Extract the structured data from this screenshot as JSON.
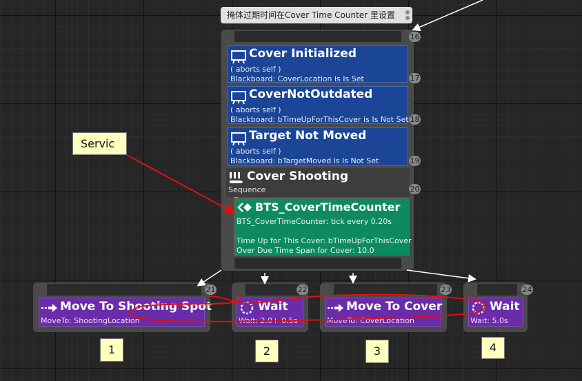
{
  "comment": {
    "text": "掩体过期时间在Cover Time Counter 里设置"
  },
  "composite": {
    "index": "16"
  },
  "decorators": [
    {
      "title": "Cover  Initialized",
      "sub1": "( aborts self )",
      "sub2": "Blackboard: CoverLocation is Is Set",
      "index": "17",
      "icon": "blackboard-icon"
    },
    {
      "title": "CoverNotOutdated",
      "sub1": "( aborts self )",
      "sub2": "Blackboard: bTimeUpForThisCover is Is Not Set",
      "index": "18",
      "icon": "blackboard-icon"
    },
    {
      "title": "Target Not Moved",
      "sub1": "( aborts self )",
      "sub2": "Blackboard: bTargetMoved is Is Not Set",
      "index": "19",
      "icon": "blackboard-icon"
    }
  ],
  "sequence": {
    "title": "Cover Shooting",
    "sub": "Sequence",
    "index": "20",
    "icon": "sequence-icon"
  },
  "service": {
    "title": "BTS_CoverTimeCounter",
    "line1": "BTS_CoverTimeCounter: tick every 0.20s",
    "line2": "Time Up for This Cover: bTimeUpForThisCover",
    "line3": "Over Due Time Span for Cover: 10.0",
    "icon": "service-icon"
  },
  "tasks": [
    {
      "title": "Move To Shooting Spot",
      "sub": "MoveTo: ShootingLocation",
      "index": "21",
      "icon": "moveto-icon"
    },
    {
      "title": "Wait",
      "sub": "Wait: 2.0+-0.5s",
      "index": "22",
      "icon": "wait-icon"
    },
    {
      "title": "Move To Cover",
      "sub": "MoveTo: CoverLocation",
      "index": "23",
      "icon": "moveto-icon"
    },
    {
      "title": "Wait",
      "sub": "Wait: 5.0s",
      "index": "24",
      "icon": "wait-icon"
    }
  ],
  "annotations": {
    "service_label": "Servic",
    "labels": [
      "1",
      "2",
      "3",
      "4"
    ]
  },
  "colors": {
    "decorator": "#1b4596",
    "service": "#0e8a63",
    "task": "#6a2ca8",
    "annotation_red": "#e01010",
    "annotation_box": "#ffffc0"
  }
}
